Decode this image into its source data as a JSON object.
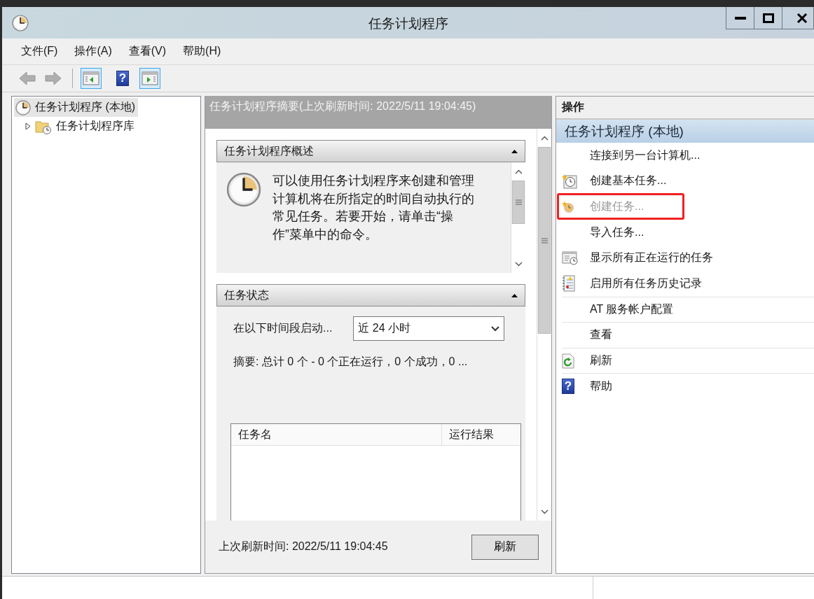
{
  "window": {
    "title": "任务计划程序"
  },
  "menu": [
    "文件(F)",
    "操作(A)",
    "查看(V)",
    "帮助(H)"
  ],
  "toolbar": [
    {
      "kind": "back",
      "disabled": true,
      "pressed": false
    },
    {
      "kind": "forward",
      "disabled": true,
      "pressed": false
    },
    {
      "kind": "tree-toggle",
      "disabled": false,
      "pressed": true
    },
    {
      "kind": "help",
      "glyph": "?",
      "disabled": false,
      "pressed": false
    },
    {
      "kind": "action-toggle",
      "disabled": false,
      "pressed": true
    }
  ],
  "tree": {
    "items": [
      {
        "label": "任务计划程序 (本地)",
        "selected": true,
        "children": [
          {
            "label": "任务计划程序库",
            "selected": false,
            "expanded": false
          }
        ]
      }
    ]
  },
  "summary": {
    "header": "任务计划程序摘要(上次刷新时间: 2022/5/11 19:04:45)",
    "overview": {
      "title": "任务计划程序概述",
      "expanded": true,
      "paragraphs": [
        "可以使用任务计划程序来创建和管理计算机将在所指定的时间自动执行的常见任务。若要开始，请单击“操作”菜单中的命令。"
      ]
    },
    "status": {
      "title": "任务状态",
      "expanded": true,
      "period_label": "在以下时间段启动...",
      "period": "近 24 小时",
      "summary": "摘要: 总计 0 个 - 0 个正在运行，0 个成功，0 ...",
      "columns": [
        "任务名",
        "运行结果"
      ]
    },
    "last_refresh": "上次刷新时间: 2022/5/11 19:04:45",
    "refresh_button": "刷新"
  },
  "actions": {
    "header": "操作",
    "group": "任务计划程序 (本地)",
    "items": [
      {
        "label": "连接到另一台计算机...",
        "kind": "plain",
        "disabled": false,
        "highlighted": false,
        "separator_before": false
      },
      {
        "label": "创建基本任务...",
        "kind": "basic-task",
        "disabled": false,
        "highlighted": false,
        "separator_before": false
      },
      {
        "label": "创建任务...",
        "kind": "task",
        "disabled": true,
        "highlighted": true,
        "separator_before": false
      },
      {
        "label": "导入任务...",
        "kind": "plain",
        "disabled": false,
        "highlighted": false,
        "separator_before": false
      },
      {
        "label": "显示所有正在运行的任务",
        "kind": "running",
        "disabled": false,
        "highlighted": false,
        "separator_before": false
      },
      {
        "label": "启用所有任务历史记录",
        "kind": "history",
        "disabled": false,
        "highlighted": false,
        "separator_before": false
      },
      {
        "label": "AT 服务帐户配置",
        "kind": "plain",
        "disabled": false,
        "highlighted": false,
        "separator_before": true
      },
      {
        "label": "查看",
        "kind": "plain",
        "disabled": false,
        "highlighted": false,
        "separator_before": true
      },
      {
        "label": "刷新",
        "kind": "refresh",
        "disabled": false,
        "highlighted": false,
        "separator_before": true
      },
      {
        "label": "帮助",
        "kind": "help",
        "glyph": "?",
        "disabled": false,
        "highlighted": false,
        "separator_before": true
      }
    ]
  }
}
